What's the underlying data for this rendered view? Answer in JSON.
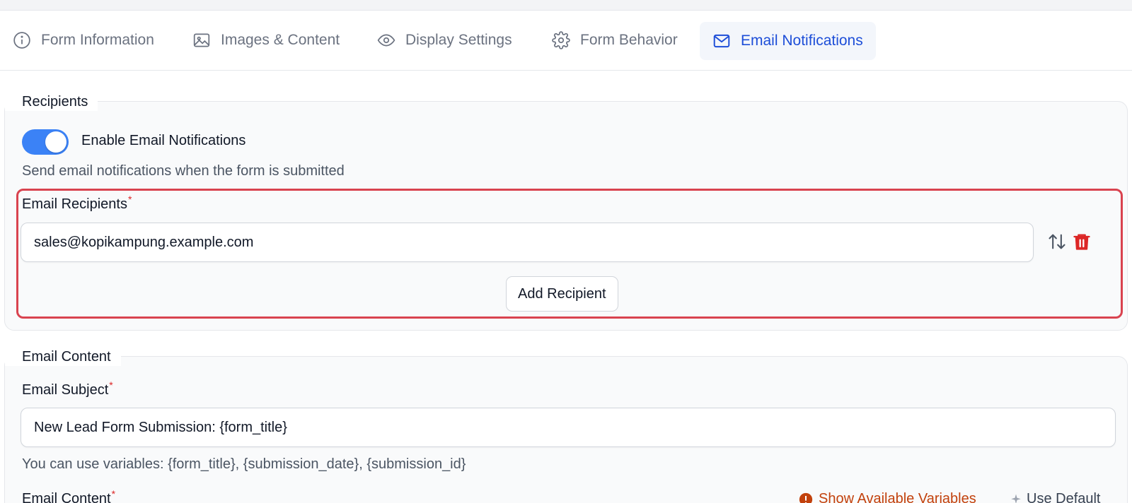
{
  "tabs": [
    {
      "label": "Form Information",
      "icon": "info-icon"
    },
    {
      "label": "Images & Content",
      "icon": "image-icon"
    },
    {
      "label": "Display Settings",
      "icon": "eye-icon"
    },
    {
      "label": "Form Behavior",
      "icon": "gear-icon"
    },
    {
      "label": "Email Notifications",
      "icon": "mail-icon",
      "active": true
    }
  ],
  "recipients": {
    "legend": "Recipients",
    "toggle": {
      "label": "Enable Email Notifications",
      "on": true
    },
    "help": "Send email notifications when the form is submitted",
    "field_label": "Email Recipients",
    "required_mark": "*",
    "emails": [
      "sales@kopikampung.example.com"
    ],
    "add_button": "Add Recipient",
    "highlight_color": "#d9434f"
  },
  "content": {
    "legend": "Email Content",
    "subject_label": "Email Subject",
    "required_mark": "*",
    "subject_value": "New Lead Form Submission: {form_title}",
    "subject_help": "You can use variables: {form_title}, {submission_date}, {submission_id}",
    "content_label": "Email Content",
    "show_variables": "Show Available Variables",
    "use_default": "Use Default"
  },
  "colors": {
    "accent": "#3b82f6",
    "active_tab": "#1d4ed8",
    "danger": "#dc2626",
    "warning": "#c2410c"
  }
}
